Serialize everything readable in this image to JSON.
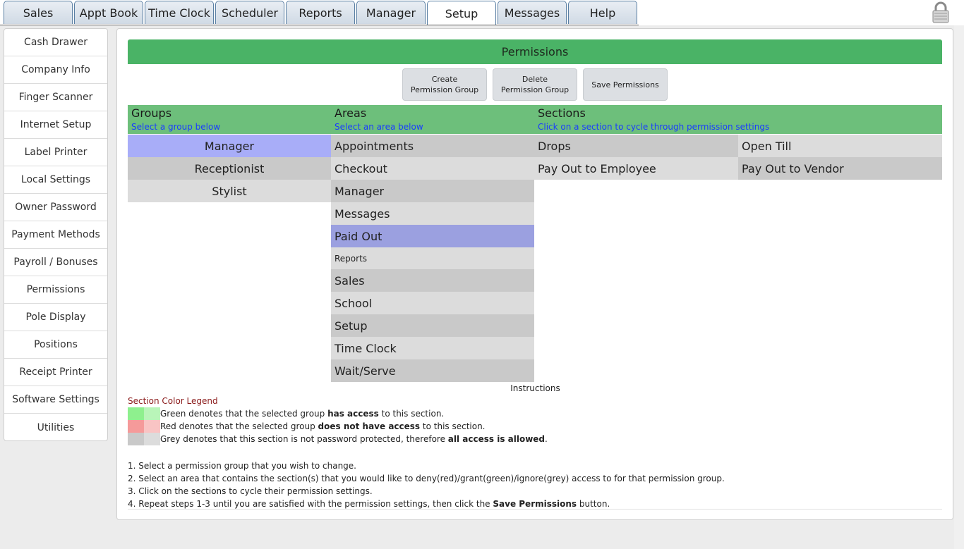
{
  "tabs": [
    {
      "label": "Sales",
      "active": false
    },
    {
      "label": "Appt Book",
      "active": false
    },
    {
      "label": "Time Clock",
      "active": false
    },
    {
      "label": "Scheduler",
      "active": false
    },
    {
      "label": "Reports",
      "active": false
    },
    {
      "label": "Manager",
      "active": false
    },
    {
      "label": "Setup",
      "active": true
    },
    {
      "label": "Messages",
      "active": false
    },
    {
      "label": "Help",
      "active": false
    }
  ],
  "lock_icon": "lock-icon",
  "sidebar": {
    "items": [
      {
        "label": "Cash Drawer"
      },
      {
        "label": "Company Info"
      },
      {
        "label": "Finger Scanner"
      },
      {
        "label": "Internet Setup"
      },
      {
        "label": "Label Printer"
      },
      {
        "label": "Local Settings"
      },
      {
        "label": "Owner Password"
      },
      {
        "label": "Payment Methods"
      },
      {
        "label": "Payroll / Bonuses"
      },
      {
        "label": "Permissions"
      },
      {
        "label": "Pole Display"
      },
      {
        "label": "Positions"
      },
      {
        "label": "Receipt Printer"
      },
      {
        "label": "Software Settings"
      },
      {
        "label": "Utilities"
      }
    ]
  },
  "main": {
    "title": "Permissions",
    "buttons": {
      "create": "Create Permission Group",
      "delete": "Delete Permission Group",
      "save": "Save Permissions"
    },
    "headers": {
      "groups": {
        "title": "Groups",
        "sub": "Select a group below"
      },
      "areas": {
        "title": "Areas",
        "sub": "Select an area below"
      },
      "sections": {
        "title": "Sections",
        "sub": "Click on a section to cycle through permission settings"
      }
    },
    "groups": [
      {
        "label": "Manager",
        "selected": true
      },
      {
        "label": "Receptionist",
        "selected": false
      },
      {
        "label": "Stylist",
        "selected": false
      }
    ],
    "areas": [
      {
        "label": "Appointments"
      },
      {
        "label": "Checkout"
      },
      {
        "label": "Manager"
      },
      {
        "label": "Messages"
      },
      {
        "label": "Paid Out",
        "selected": true
      },
      {
        "label": "Reports"
      },
      {
        "label": "Sales"
      },
      {
        "label": "School"
      },
      {
        "label": "Setup"
      },
      {
        "label": "Time Clock"
      },
      {
        "label": "Wait/Serve"
      }
    ],
    "sections": [
      {
        "label": "Drops"
      },
      {
        "label": "Open Till"
      },
      {
        "label": "Pay Out to Employee"
      },
      {
        "label": "Pay Out to Vendor"
      }
    ],
    "instructions_title": "Instructions",
    "legend": {
      "title": "Section Color Legend",
      "green": {
        "pre": "Green denotes that the selected group ",
        "bold": "has access",
        "post": " to this section.",
        "colors": [
          "#8ef08e",
          "#b9f5b9"
        ]
      },
      "red": {
        "pre": "Red denotes that the selected group ",
        "bold": "does not have access",
        "post": " to this section.",
        "colors": [
          "#f59a9a",
          "#f9c4c4"
        ]
      },
      "grey": {
        "pre": "Grey denotes that this section is not password protected, therefore ",
        "bold": "all access is allowed",
        "post": ".",
        "colors": [
          "#c9c9c9",
          "#dcdcdc"
        ]
      }
    },
    "steps": [
      {
        "text": "1. Select a permission group that you wish to change."
      },
      {
        "text": "2. Select an area that contains the section(s) that you would like to deny(red)/grant(green)/ignore(grey) access to for that permission group."
      },
      {
        "text": "3. Click on the sections to cycle their permission settings."
      },
      {
        "pre": "4. Repeat steps 1-3 until you are satisfied with the permission settings, then click the ",
        "bold": "Save Permissions",
        "post": " button."
      }
    ]
  }
}
